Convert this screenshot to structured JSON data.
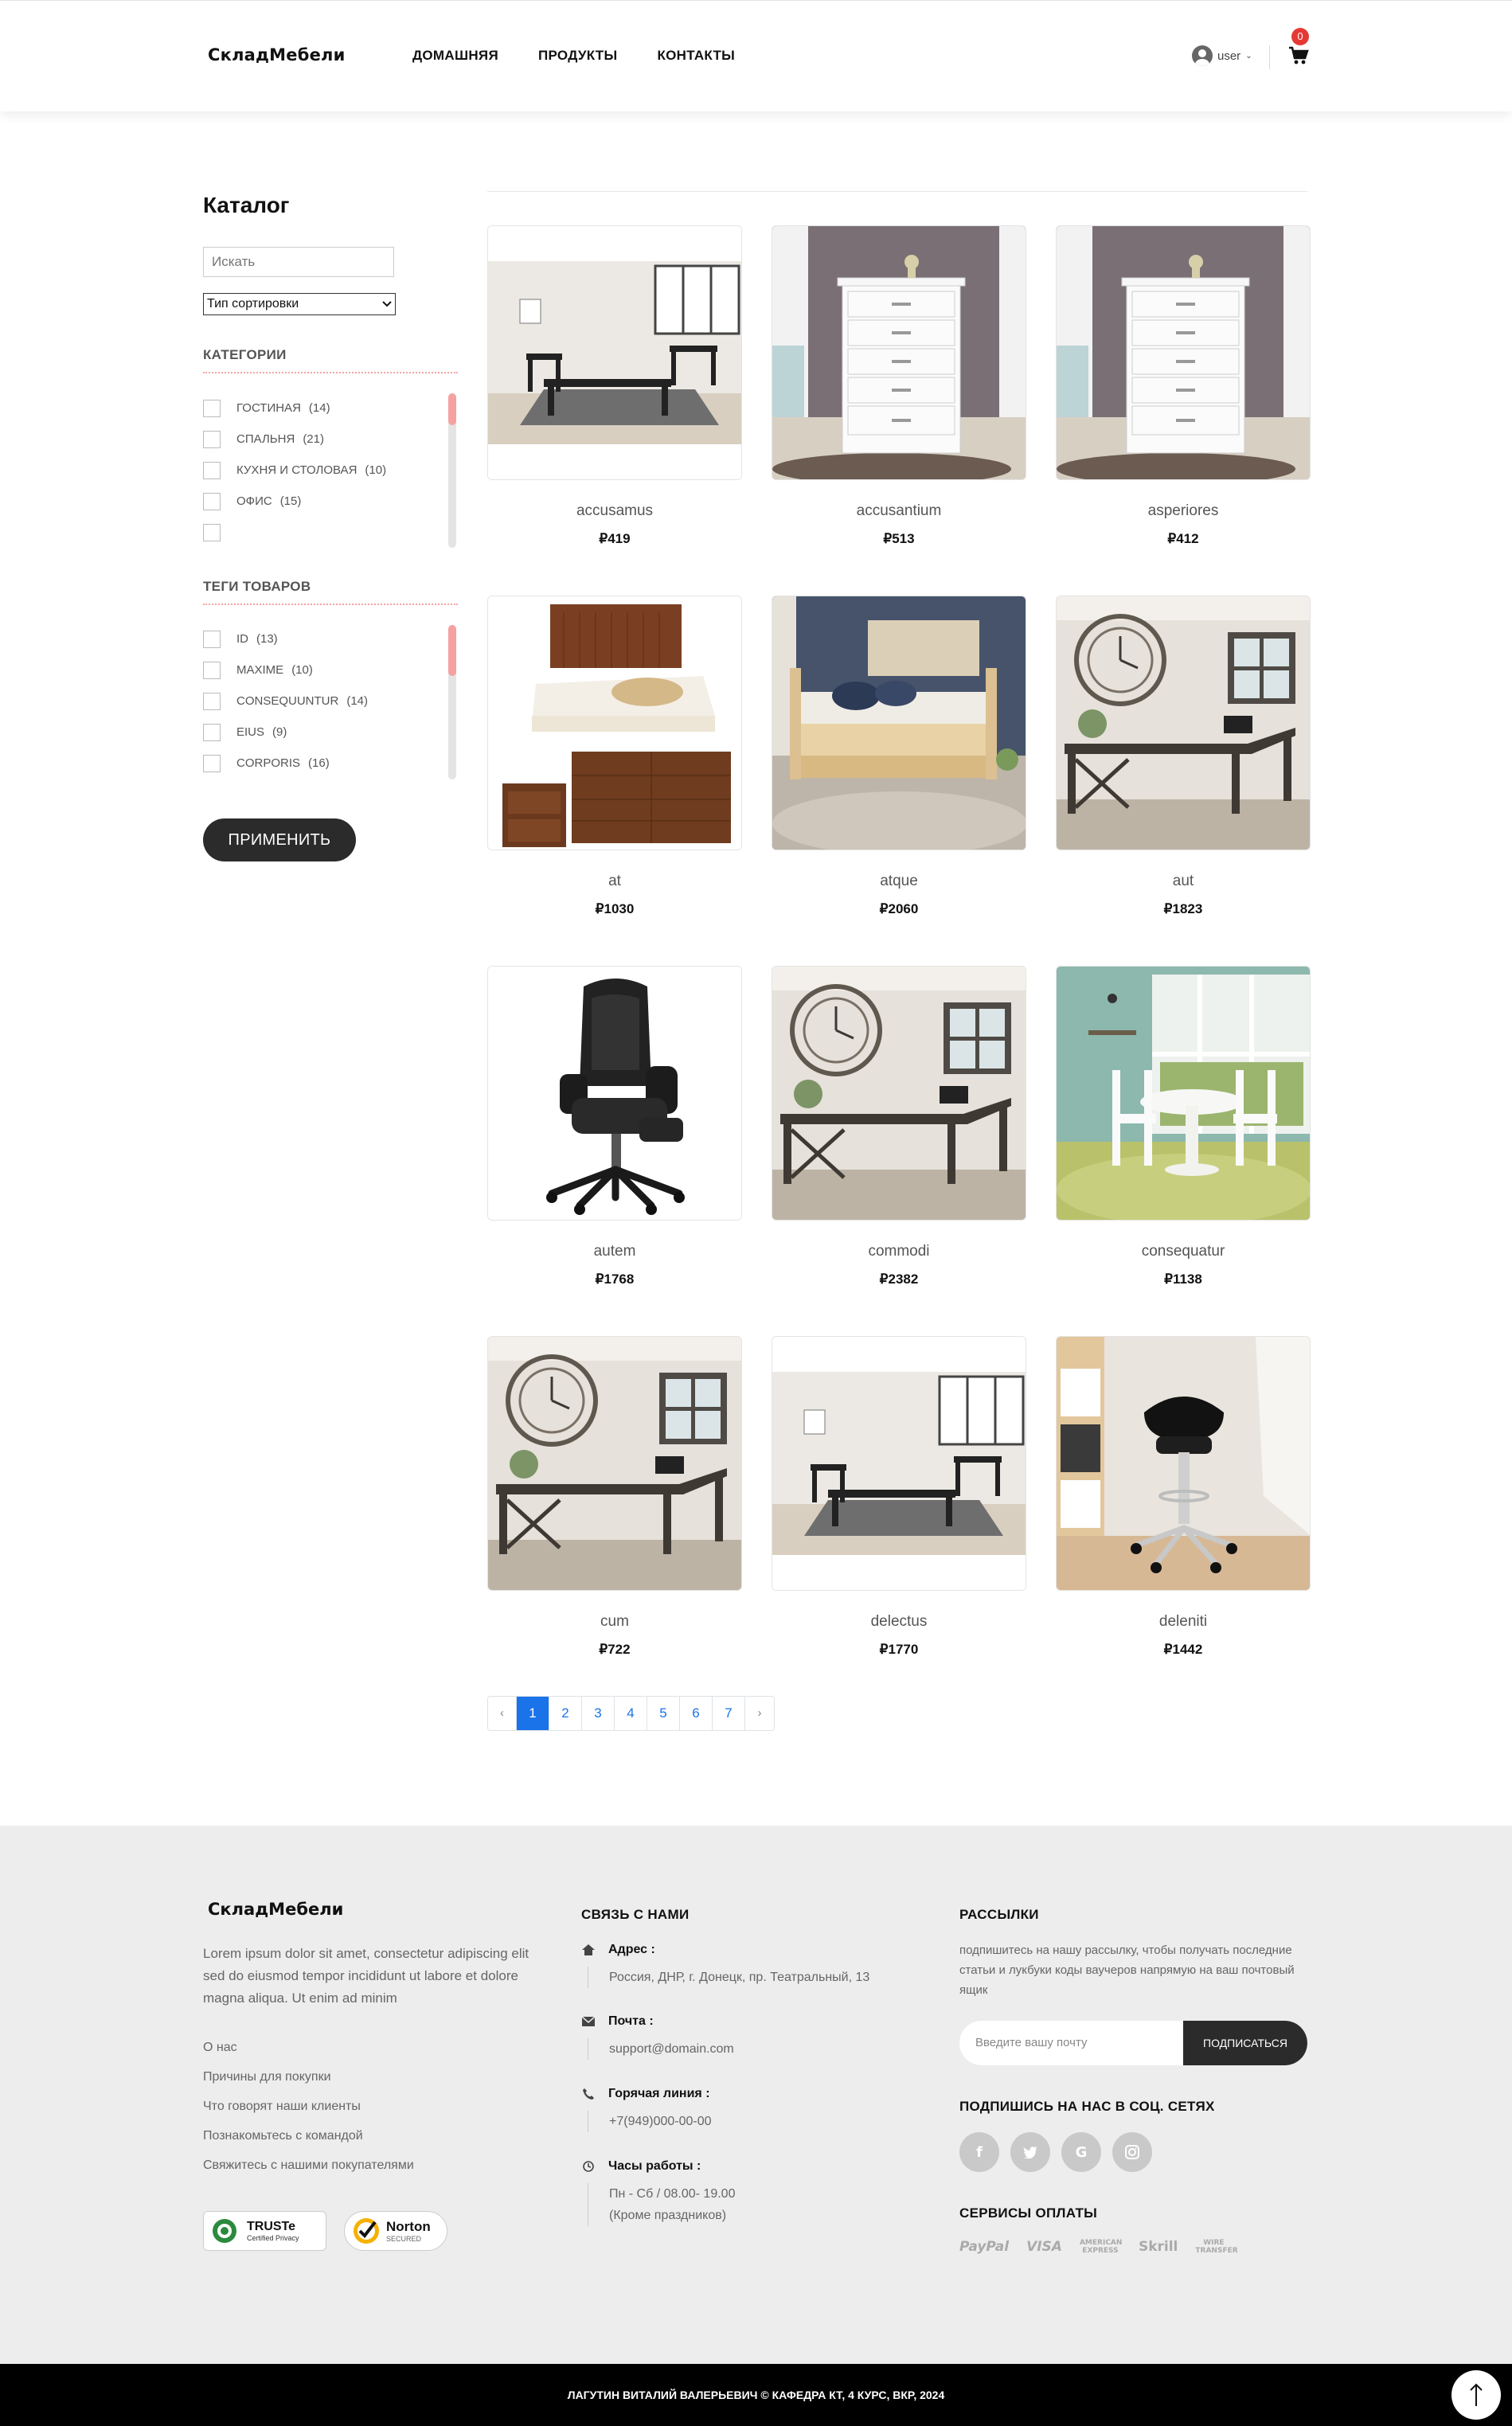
{
  "header": {
    "logo": "СкладМебели",
    "nav": [
      "ДОМАШНЯЯ",
      "ПРОДУКТЫ",
      "КОНТАКТЫ"
    ],
    "user_label": "user",
    "cart_count": "0"
  },
  "sidebar": {
    "title": "Каталог",
    "search_placeholder": "Искать",
    "sort_label": "Тип сортировки",
    "categories_title": "КАТЕГОРИИ",
    "categories": [
      {
        "label": "ГОСТИНАЯ",
        "count": "(14)"
      },
      {
        "label": "СПАЛЬНЯ",
        "count": "(21)"
      },
      {
        "label": "КУХНЯ И СТОЛОВАЯ",
        "count": "(10)"
      },
      {
        "label": "ОФИС",
        "count": "(15)"
      },
      {
        "label": "",
        "count": ""
      }
    ],
    "tags_title": "ТЕГИ ТОВАРОВ",
    "tags": [
      {
        "label": "ID",
        "count": "(13)"
      },
      {
        "label": "MAXIME",
        "count": "(10)"
      },
      {
        "label": "CONSEQUUNTUR",
        "count": "(14)"
      },
      {
        "label": "EIUS",
        "count": "(9)"
      },
      {
        "label": "CORPORIS",
        "count": "(16)"
      }
    ],
    "apply_label": "ПРИМЕНИТЬ"
  },
  "products": [
    {
      "name": "accusamus",
      "price": "₽419",
      "image": "living-room-table-set"
    },
    {
      "name": "accusantium",
      "price": "₽513",
      "image": "white-dresser"
    },
    {
      "name": "asperiores",
      "price": "₽412",
      "image": "white-dresser"
    },
    {
      "name": "at",
      "price": "₽1030",
      "image": "bedroom-set"
    },
    {
      "name": "atque",
      "price": "₽2060",
      "image": "daybed"
    },
    {
      "name": "aut",
      "price": "₽1823",
      "image": "office-desk"
    },
    {
      "name": "autem",
      "price": "₽1768",
      "image": "gaming-chair"
    },
    {
      "name": "commodi",
      "price": "₽2382",
      "image": "office-desk"
    },
    {
      "name": "consequatur",
      "price": "₽1138",
      "image": "dining-set"
    },
    {
      "name": "cum",
      "price": "₽722",
      "image": "office-desk"
    },
    {
      "name": "delectus",
      "price": "₽1770",
      "image": "living-room-table-set"
    },
    {
      "name": "deleniti",
      "price": "₽1442",
      "image": "bar-stool"
    }
  ],
  "pagination": {
    "prev": "‹",
    "pages": [
      "1",
      "2",
      "3",
      "4",
      "5",
      "6",
      "7"
    ],
    "active": "1",
    "next": "›"
  },
  "footer": {
    "logo": "СкладМебели",
    "description": "Lorem ipsum dolor sit amet, consectetur adipiscing elit sed do eiusmod tempor incididunt ut labore et dolore magna aliqua. Ut enim ad minim",
    "links": [
      "О нас",
      "Причины для покупки",
      "Что говорят наши клиенты",
      "Познакомьтесь с командой",
      "Свяжитесь с нашими покупателями"
    ],
    "badges": {
      "truste": "TRUSTe",
      "truste_sub": "Certified Privacy",
      "norton": "Norton",
      "norton_sub": "SECURED"
    },
    "contact_title": "СВЯЗЬ С НАМИ",
    "contact": {
      "address_label": "Адрес :",
      "address": "Россия, ДНР, г. Донецк, пр. Театральный, 13",
      "mail_label": "Почта :",
      "mail": "support@domain.com",
      "phone_label": "Горячая линия :",
      "phone": "+7(949)000-00-00",
      "hours_label": "Часы работы :",
      "hours": "Пн - Сб / 08.00- 19.00",
      "hours_note": "(Кроме праздников)"
    },
    "newsletter_title": "РАССЫЛКИ",
    "newsletter_desc": "подпишитесь на нашу рассылку, чтобы получать последние статьи и лукбуки коды ваучеров напрямую на ваш почтовый ящик",
    "email_placeholder": "Введите вашу почту",
    "subscribe_label": "ПОДПИСАТЬСЯ",
    "social_title": "ПОДПИШИСЬ НА НАС В СОЦ. СЕТЯХ",
    "social": [
      "f",
      "t",
      "G",
      "i"
    ],
    "payment_title": "СЕРВИСЫ ОПЛАТЫ",
    "payments": [
      "PayPal",
      "VISA",
      "AMERICAN EXPRESS",
      "Skrill",
      "WIRE TRANSFER"
    ]
  },
  "bottom_bar": "ЛАГУТИН ВИТАЛИЙ ВАЛЕРЬЕВИЧ © КАФЕДРА КТ, 4 КУРС, ВКР, 2024"
}
